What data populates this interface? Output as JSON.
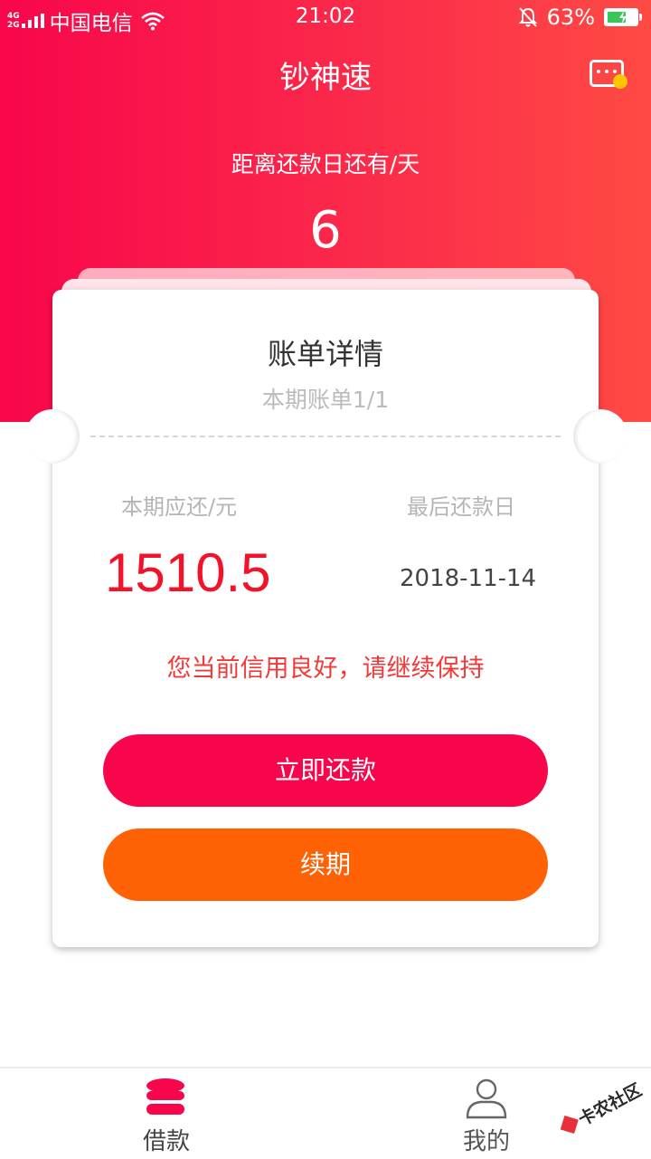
{
  "status_bar": {
    "network_top": "4G",
    "network_bottom": "2G",
    "carrier": "中国电信",
    "time": "21:02",
    "battery": "63%",
    "icons": [
      "signal-icon",
      "wifi-icon",
      "bell-muted-icon",
      "battery-icon"
    ]
  },
  "header": {
    "title": "钞神速",
    "message_icon": "message-icon"
  },
  "countdown": {
    "label": "距离还款日还有/天",
    "days": "6"
  },
  "bill": {
    "title": "账单详情",
    "period": "本期账单1/1",
    "due_label": "本期应还/元",
    "due_amount": "1510.5",
    "last_day_label": "最后还款日",
    "last_day": "2018-11-14",
    "credit_message": "您当前信用良好，请继续保持"
  },
  "actions": {
    "repay_label": "立即还款",
    "renew_label": "续期"
  },
  "tabbar": {
    "items": [
      {
        "label": "借款",
        "icon": "coins-icon",
        "active": true
      },
      {
        "label": "我的",
        "icon": "person-icon",
        "active": false
      }
    ]
  },
  "watermark": {
    "text": "卡农社区"
  },
  "colors": {
    "brand": "#f8064b",
    "renew": "#ff6105",
    "amount": "#f21229",
    "credit_text": "#f03a3a"
  }
}
